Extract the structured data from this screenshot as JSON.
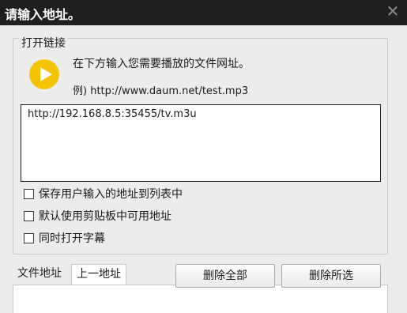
{
  "window": {
    "title": "请输入地址。",
    "close_glyph": "✕"
  },
  "open_link": {
    "legend": "打开链接",
    "instruction": "在下方输入您需要播放的文件网址。",
    "example": "例) http://www.daum.net/test.mp3",
    "url_value": "http://192.168.8.5:35455/tv.m3u",
    "icon": "play-icon",
    "icon_color": "#f5c400"
  },
  "options": [
    {
      "label": "保存用户输入的地址到列表中",
      "checked": false
    },
    {
      "label": "默认使用剪贴板中可用地址",
      "checked": false
    },
    {
      "label": "同时打开字幕",
      "checked": false
    }
  ],
  "tabs": [
    {
      "label": "文件地址",
      "active": false
    },
    {
      "label": "上一地址",
      "active": true
    }
  ],
  "buttons": {
    "delete_all": "删除全部",
    "delete_selected": "删除所选"
  }
}
